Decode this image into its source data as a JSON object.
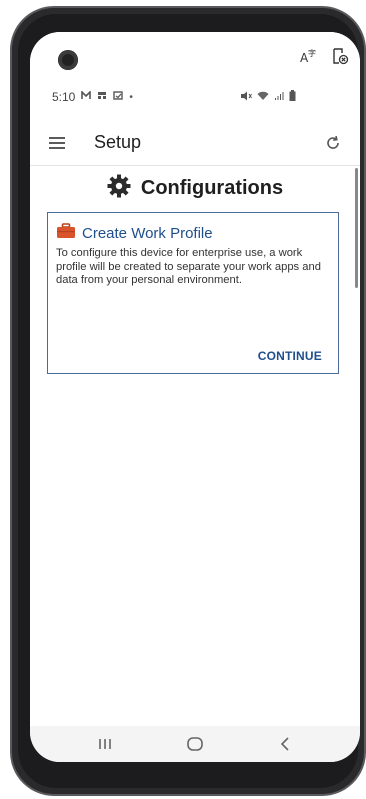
{
  "status_bar": {
    "time": "5:10"
  },
  "app_bar": {
    "title": "Setup"
  },
  "section": {
    "title": "Configurations"
  },
  "card": {
    "title": "Create Work Profile",
    "body": "To configure this device for enterprise use, a work profile will be created to separate your work apps and data from your personal environment.",
    "action_label": "CONTINUE"
  },
  "colors": {
    "accent": "#1e4f8c",
    "briefcase": "#d9532b"
  },
  "icons": {
    "top": [
      "camera-icon",
      "text-size-icon",
      "screenshot-icon"
    ],
    "app_bar": [
      "menu-icon",
      "refresh-icon"
    ],
    "section": "gear-icon",
    "card": "briefcase-icon",
    "nav": [
      "recents-icon",
      "home-icon",
      "back-icon"
    ]
  }
}
